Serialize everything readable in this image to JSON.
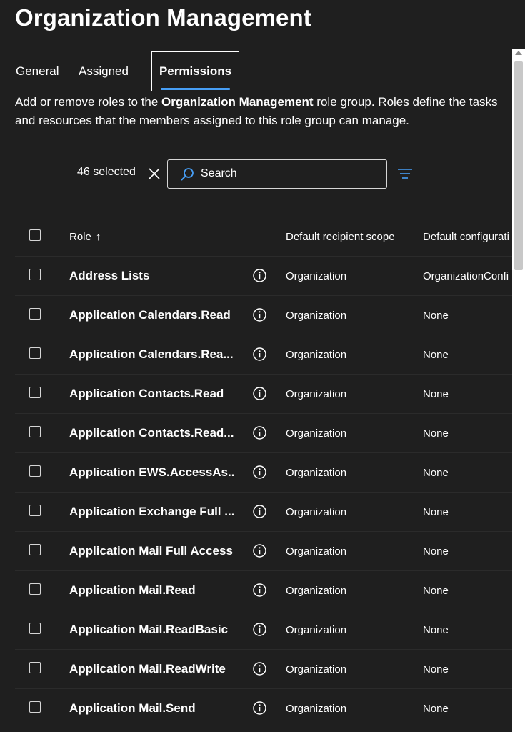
{
  "title": "Organization Management",
  "tabs": [
    {
      "label": "General"
    },
    {
      "label": "Assigned"
    },
    {
      "label": "Permissions"
    }
  ],
  "description": {
    "prefix": "Add or remove roles to the ",
    "bold": "Organization Management",
    "suffix": " role group. Roles define the tasks and resources that the members assigned to this role group can manage."
  },
  "toolbar": {
    "selected_text": "46 selected",
    "search_placeholder": "Search"
  },
  "table": {
    "headers": {
      "role": "Role",
      "scope": "Default recipient scope",
      "config": "Default configurati"
    },
    "rows": [
      {
        "role": "Address Lists",
        "scope": "Organization",
        "config": "OrganizationConfi"
      },
      {
        "role": "Application Calendars.Read",
        "scope": "Organization",
        "config": "None"
      },
      {
        "role": "Application Calendars.Rea...",
        "scope": "Organization",
        "config": "None"
      },
      {
        "role": "Application Contacts.Read",
        "scope": "Organization",
        "config": "None"
      },
      {
        "role": "Application Contacts.Read...",
        "scope": "Organization",
        "config": "None"
      },
      {
        "role": "Application EWS.AccessAs...",
        "scope": "Organization",
        "config": "None"
      },
      {
        "role": "Application Exchange Full ...",
        "scope": "Organization",
        "config": "None"
      },
      {
        "role": "Application Mail Full Access",
        "scope": "Organization",
        "config": "None"
      },
      {
        "role": "Application Mail.Read",
        "scope": "Organization",
        "config": "None"
      },
      {
        "role": "Application Mail.ReadBasic",
        "scope": "Organization",
        "config": "None"
      },
      {
        "role": "Application Mail.ReadWrite",
        "scope": "Organization",
        "config": "None"
      },
      {
        "role": "Application Mail.Send",
        "scope": "Organization",
        "config": "None"
      }
    ]
  },
  "colors": {
    "background": "#1f1f1f",
    "accent": "#479ef5",
    "text": "#ffffff"
  },
  "icons": {
    "clear": "close-icon",
    "search": "search-icon",
    "filter": "filter-icon",
    "info": "info-icon",
    "sort": "sort-ascending-icon"
  }
}
